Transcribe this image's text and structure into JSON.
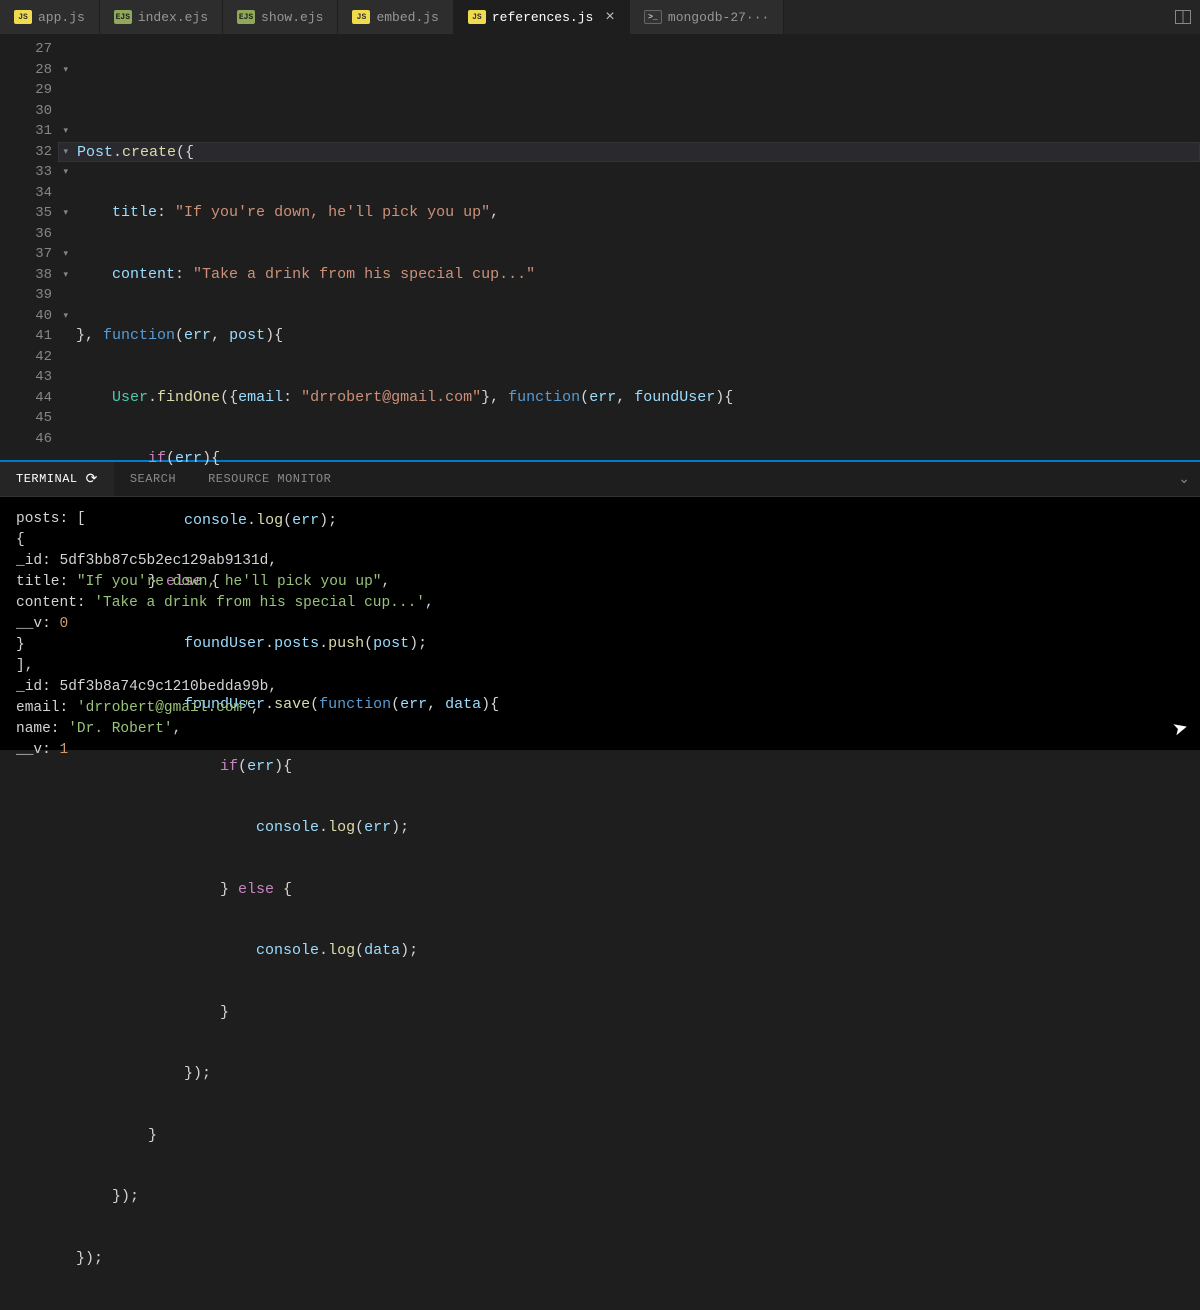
{
  "tabs": [
    {
      "icon": "JS",
      "iconClass": "js",
      "label": "app.js",
      "active": false,
      "close": false
    },
    {
      "icon": "EJS",
      "iconClass": "ejs",
      "label": "index.ejs",
      "active": false,
      "close": false
    },
    {
      "icon": "EJS",
      "iconClass": "ejs",
      "label": "show.ejs",
      "active": false,
      "close": false
    },
    {
      "icon": "JS",
      "iconClass": "js",
      "label": "embed.js",
      "active": false,
      "close": false
    },
    {
      "icon": "JS",
      "iconClass": "js",
      "label": "references.js",
      "active": true,
      "close": true
    },
    {
      "icon": ">_",
      "iconClass": "shell",
      "label": "mongodb-27···",
      "active": false,
      "close": false
    }
  ],
  "gutter": [
    {
      "n": "27",
      "fold": false
    },
    {
      "n": "28",
      "fold": true
    },
    {
      "n": "29",
      "fold": false
    },
    {
      "n": "30",
      "fold": false
    },
    {
      "n": "31",
      "fold": true
    },
    {
      "n": "32",
      "fold": true
    },
    {
      "n": "33",
      "fold": true
    },
    {
      "n": "34",
      "fold": false
    },
    {
      "n": "35",
      "fold": true
    },
    {
      "n": "36",
      "fold": false
    },
    {
      "n": "37",
      "fold": true
    },
    {
      "n": "38",
      "fold": true
    },
    {
      "n": "39",
      "fold": false
    },
    {
      "n": "40",
      "fold": true
    },
    {
      "n": "41",
      "fold": false
    },
    {
      "n": "42",
      "fold": false
    },
    {
      "n": "43",
      "fold": false
    },
    {
      "n": "44",
      "fold": false
    },
    {
      "n": "45",
      "fold": false
    },
    {
      "n": "46",
      "fold": false
    }
  ],
  "code": {
    "l27": "",
    "l28_a": "Post",
    "l28_b": ".",
    "l28_c": "create",
    "l28_d": "({",
    "l29_a": "    ",
    "l29_b": "title",
    "l29_c": ": ",
    "l29_d": "\"If you're down, he'll pick you up\"",
    "l29_e": ",",
    "l30_a": "    ",
    "l30_b": "content",
    "l30_c": ": ",
    "l30_d": "\"Take a drink from his special cup...\"",
    "l31_a": "}, ",
    "l31_b": "function",
    "l31_c": "(",
    "l31_d": "err",
    "l31_e": ", ",
    "l31_f": "post",
    "l31_g": "){",
    "l32_a": "    ",
    "l32_b": "User",
    "l32_c": ".",
    "l32_d": "findOne",
    "l32_e": "({",
    "l32_f": "email",
    "l32_g": ": ",
    "l32_h": "\"drrobert@gmail.com\"",
    "l32_i": "}, ",
    "l32_j": "function",
    "l32_k": "(",
    "l32_l": "err",
    "l32_m": ", ",
    "l32_n": "foundUser",
    "l32_o": "){",
    "l33_a": "        ",
    "l33_b": "if",
    "l33_c": "(",
    "l33_d": "err",
    "l33_e": "){",
    "l34_a": "            ",
    "l34_b": "console",
    "l34_c": ".",
    "l34_d": "log",
    "l34_e": "(",
    "l34_f": "err",
    "l34_g": ");",
    "l35_a": "        } ",
    "l35_b": "else",
    "l35_c": " {",
    "l36_a": "            ",
    "l36_b": "foundUser",
    "l36_c": ".",
    "l36_d": "posts",
    "l36_e": ".",
    "l36_f": "push",
    "l36_g": "(",
    "l36_h": "post",
    "l36_i": ");",
    "l37_a": "            ",
    "l37_b": "foundUser",
    "l37_c": ".",
    "l37_d": "save",
    "l37_e": "(",
    "l37_f": "function",
    "l37_g": "(",
    "l37_h": "err",
    "l37_i": ", ",
    "l37_j": "data",
    "l37_k": "){",
    "l38_a": "                ",
    "l38_b": "if",
    "l38_c": "(",
    "l38_d": "err",
    "l38_e": "){",
    "l39_a": "                    ",
    "l39_b": "console",
    "l39_c": ".",
    "l39_d": "log",
    "l39_e": "(",
    "l39_f": "err",
    "l39_g": ");",
    "l40_a": "                } ",
    "l40_b": "else",
    "l40_c": " {",
    "l41_a": "                    ",
    "l41_b": "console",
    "l41_c": ".",
    "l41_d": "log",
    "l41_e": "(",
    "l41_f": "data",
    "l41_g": ");",
    "l42_a": "                }",
    "l43_a": "            });",
    "l44_a": "        }",
    "l45_a": "    });",
    "l46_a": "});"
  },
  "panel": {
    "tabs": [
      {
        "label": "TERMINAL",
        "active": true,
        "refresh": true
      },
      {
        "label": "SEARCH",
        "active": false,
        "refresh": false
      },
      {
        "label": "RESOURCE MONITOR",
        "active": false,
        "refresh": false
      }
    ]
  },
  "terminal": {
    "l1": "posts: [",
    "l2": "  {",
    "l3_a": "    _id: ",
    "l3_b": "5df3bb87c5b2ec129ab9131d",
    "l3_c": ",",
    "l4_a": "    title: ",
    "l4_b": "\"If you're down, he'll pick you up\"",
    "l4_c": ",",
    "l5_a": "    content: ",
    "l5_b": "'Take a drink from his special cup...'",
    "l5_c": ",",
    "l6_a": "    __v: ",
    "l6_b": "0",
    "l7": "  }",
    "l8": "],",
    "l9_a": "_id: ",
    "l9_b": "5df3b8a74c9c1210bedda99b",
    "l9_c": ",",
    "l10_a": "email: ",
    "l10_b": "'drrobert@gmail.com'",
    "l10_c": ",",
    "l11_a": "name: ",
    "l11_b": "'Dr. Robert'",
    "l11_c": ",",
    "l12_a": "__v: ",
    "l12_b": "1"
  }
}
